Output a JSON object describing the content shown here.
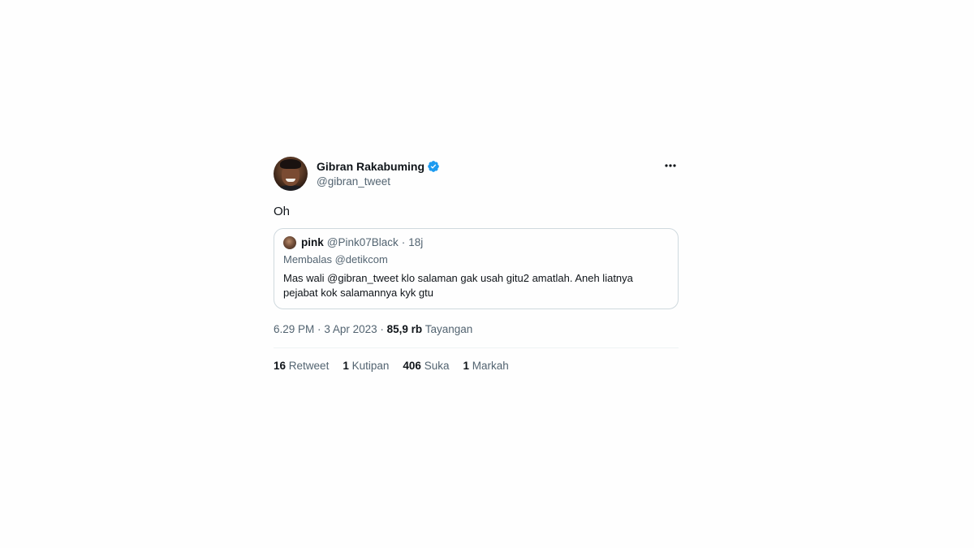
{
  "author": {
    "display_name": "Gibran Rakabuming",
    "handle": "@gibran_tweet",
    "verified_icon": "verified-badge-icon",
    "avatar_icon": "avatar"
  },
  "tweet": {
    "text": "Oh",
    "time": "6.29 PM",
    "separator": "·",
    "date": "3 Apr 2023",
    "views_count": "85,9 rb",
    "views_label": "Tayangan"
  },
  "quote": {
    "name": "pink",
    "handle": "@Pink07Black",
    "separator": "·",
    "time": "18j",
    "replying": "Membalas @detikcom",
    "text": "Mas  wali @gibran_tweet klo salaman gak usah gitu2 amatlah. Aneh liatnya pejabat kok salamannya kyk gtu"
  },
  "stats": [
    {
      "count": "16",
      "label": "Retweet"
    },
    {
      "count": "1",
      "label": "Kutipan"
    },
    {
      "count": "406",
      "label": "Suka"
    },
    {
      "count": "1",
      "label": "Markah"
    }
  ],
  "colors": {
    "verified": "#1d9bf0",
    "secondary_text": "#536471",
    "primary_text": "#0f1419",
    "border": "#cfd9de"
  }
}
